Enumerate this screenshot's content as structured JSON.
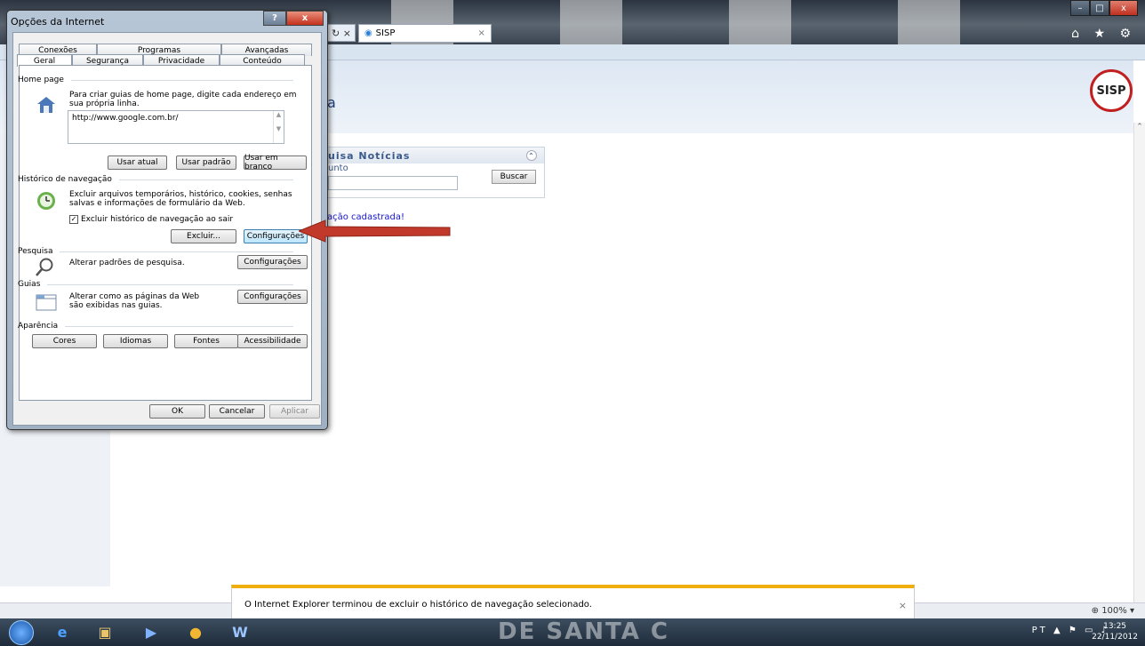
{
  "browser": {
    "tab_title": "SISP",
    "nav_buttons": "↻ ×",
    "window_controls": [
      "–",
      "□",
      "x"
    ],
    "toolbar_icons": "⌂ ★ ⚙"
  },
  "page": {
    "heading": "a",
    "logo_text": "SISP",
    "panel_title": "uisa Notícias",
    "panel_field_label": "unto",
    "search_button": "Buscar",
    "notice": "ação cadastrada!",
    "zoom": "⊕ 100%  ▾"
  },
  "notification": {
    "message": "O Internet Explorer terminou de excluir o histórico de navegação selecionado.",
    "close": "×"
  },
  "taskbar": {
    "watermark": "DE SANTA C",
    "tray": "PT  ▲ ⚑ ▭ ♪",
    "time": "13:25",
    "date": "22/11/2012"
  },
  "dialog": {
    "title": "Opções da Internet",
    "help": "?",
    "close": "x",
    "tabs_top": [
      "Conexões",
      "Programas",
      "Avançadas"
    ],
    "tabs_bottom": [
      "Geral",
      "Segurança",
      "Privacidade",
      "Conteúdo"
    ],
    "home": {
      "section": "Home page",
      "description": "Para criar guias de home page, digite cada endereço em sua própria linha.",
      "url": "http://www.google.com.br/",
      "btn_current": "Usar atual",
      "btn_default": "Usar padrão",
      "btn_blank": "Usar em branco"
    },
    "history": {
      "section": "Histórico de navegação",
      "description": "Excluir arquivos temporários, histórico, cookies, senhas salvas e informações de formulário da Web.",
      "checkbox_label": "Excluir histórico de navegação ao sair",
      "btn_delete": "Excluir...",
      "btn_settings": "Configurações"
    },
    "search": {
      "section": "Pesquisa",
      "description": "Alterar padrões de pesquisa.",
      "btn_settings": "Configurações"
    },
    "tabs_section": {
      "section": "Guias",
      "description": "Alterar como as páginas da Web são exibidas nas guias.",
      "btn_settings": "Configurações"
    },
    "appearance": {
      "section": "Aparência",
      "colors": "Cores",
      "languages": "Idiomas",
      "fonts": "Fontes",
      "accessibility": "Acessibilidade"
    },
    "footer": {
      "ok": "OK",
      "cancel": "Cancelar",
      "apply": "Aplicar"
    }
  }
}
